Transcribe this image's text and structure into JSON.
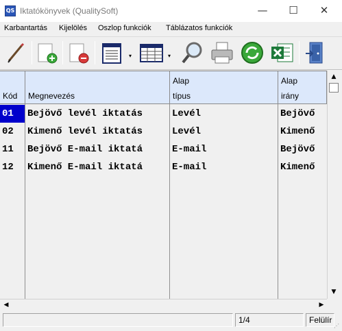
{
  "window": {
    "icon_text": "QS",
    "title": "Iktatókönyvek (QualitySoft)",
    "minimize": "—",
    "maximize": "☐",
    "close": "✕"
  },
  "menu": [
    "Karbantartás",
    "Kijelölés",
    "Oszlop funkciók",
    "Táblázatos funkciók"
  ],
  "toolbar": {
    "icons": [
      "edit-icon",
      "new-document-icon",
      "delete-document-icon",
      "list-view-icon",
      "table-view-icon",
      "search-icon",
      "print-icon",
      "refresh-icon",
      "excel-icon",
      "exit-icon"
    ],
    "caret": "▾"
  },
  "grid": {
    "headers": [
      {
        "line1": "",
        "line2": "Kód"
      },
      {
        "line1": "",
        "line2": "Megnevezés"
      },
      {
        "line1": "Alap",
        "line2": "típus"
      },
      {
        "line1": "Alap",
        "line2": "irány"
      }
    ],
    "rows": [
      {
        "kod": "01",
        "megnevezes": "Bejövő levél iktatás",
        "tipus": "Levél",
        "irany": "Bejövő"
      },
      {
        "kod": "02",
        "megnevezes": "Kimenő levél iktatás",
        "tipus": "Levél",
        "irany": "Kimenő"
      },
      {
        "kod": "11",
        "megnevezes": "Bejövő E-mail iktatá",
        "tipus": "E-mail",
        "irany": "Bejövő"
      },
      {
        "kod": "12",
        "megnevezes": "Kimenő E-mail iktatá",
        "tipus": "E-mail",
        "irany": "Kimenő"
      }
    ],
    "selected_row": 0
  },
  "scroll": {
    "up": "▲",
    "down": "▼",
    "left": "◀",
    "right": "▶"
  },
  "status": {
    "record": "1/4",
    "mode": "Felülír",
    "grip": "⋰"
  },
  "colors": {
    "header_bg": "#dce8fb",
    "selection_bg": "#0000cc",
    "accent": "#2a56b8"
  }
}
